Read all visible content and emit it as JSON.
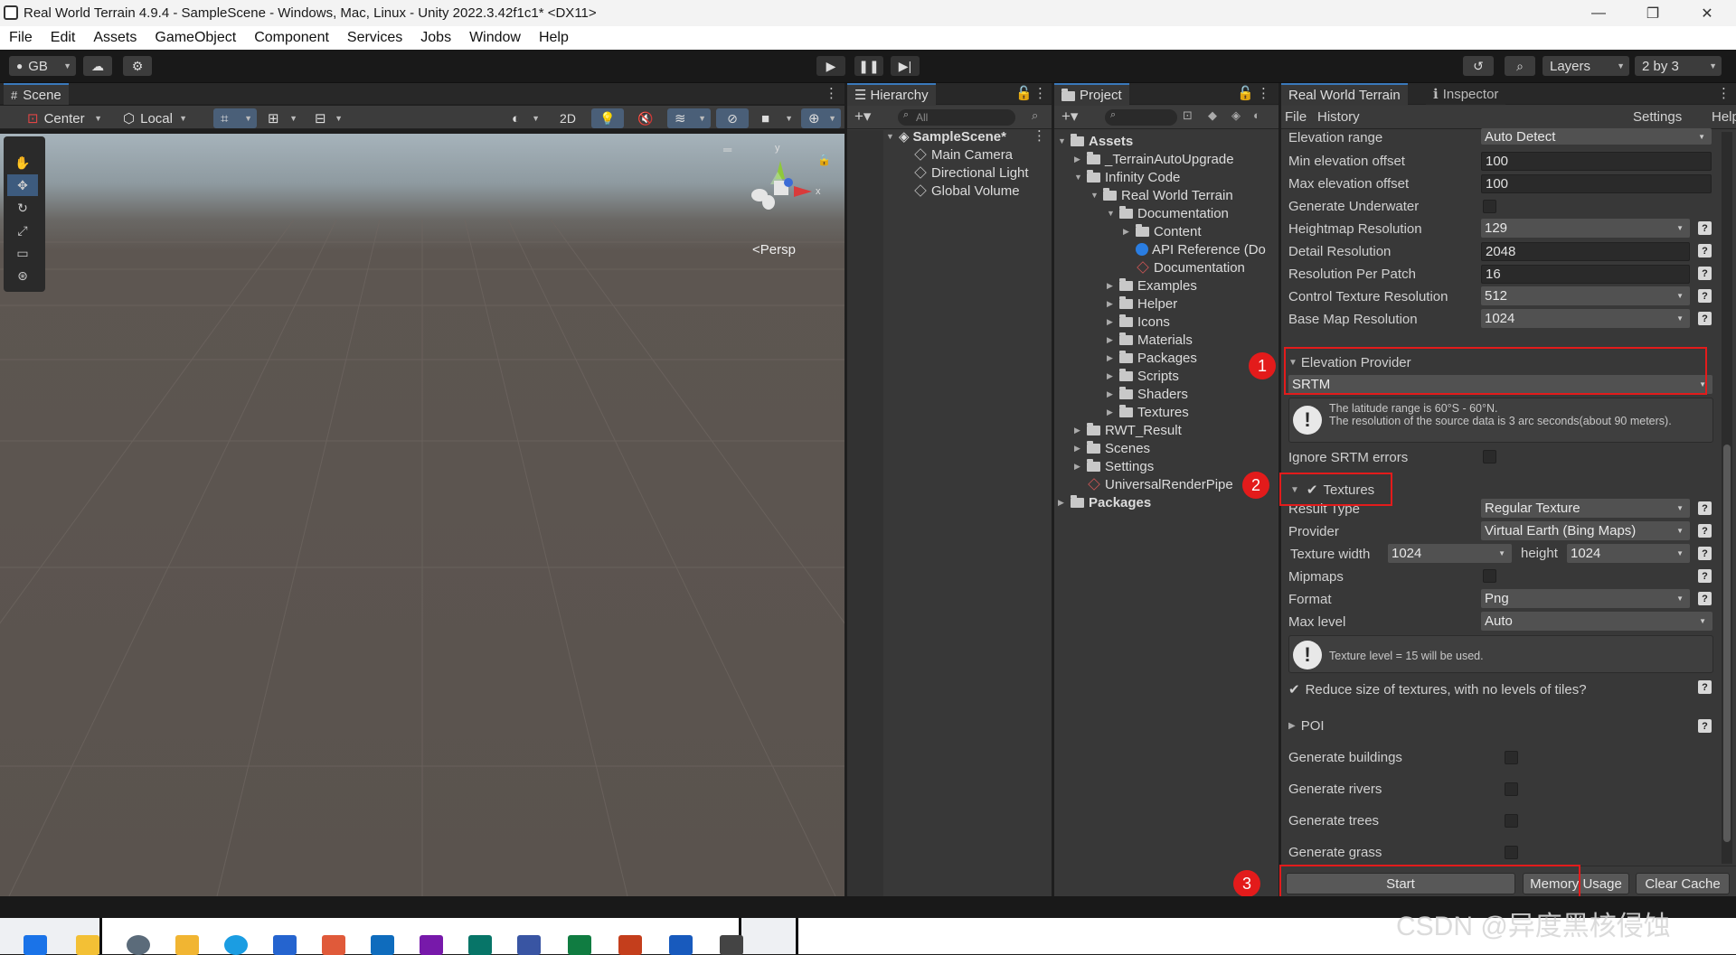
{
  "window": {
    "title": "Real World Terrain 4.9.4 - SampleScene - Windows, Mac, Linux - Unity 2022.3.42f1c1* <DX11>",
    "minimize": "—",
    "maximize": "❐",
    "close": "✕"
  },
  "menu": [
    "File",
    "Edit",
    "Assets",
    "GameObject",
    "Component",
    "Services",
    "Jobs",
    "Window",
    "Help"
  ],
  "toolbar": {
    "account": "GB",
    "layers": "Layers",
    "layout": "2 by 3"
  },
  "scene": {
    "tab": "Scene",
    "pivot": "Center",
    "space": "Local",
    "mode2d": "2D",
    "persp": "<Persp",
    "gizmo_y": "y",
    "gizmo_x": "x"
  },
  "hierarchy": {
    "tab": "Hierarchy",
    "search_placeholder": "All",
    "scene": "SampleScene*",
    "items": [
      "Main Camera",
      "Directional Light",
      "Global Volume"
    ]
  },
  "project": {
    "tab": "Project",
    "items": [
      "Assets",
      "_TerrainAutoUpgrade",
      "Infinity Code",
      "Real World Terrain",
      "Documentation",
      "Content",
      "API Reference (Do",
      "Documentation",
      "Examples",
      "Helper",
      "Icons",
      "Materials",
      "Packages",
      "Scripts",
      "Shaders",
      "Textures",
      "RWT_Result",
      "Scenes",
      "Settings",
      "UniversalRenderPipe",
      "Packages"
    ]
  },
  "rwt": {
    "tab": "Real World Terrain",
    "inspector_tab": "Inspector",
    "menu_file": "File",
    "menu_history": "History",
    "settings": "Settings",
    "help": "Help",
    "rows": [
      {
        "label": "Elevation range",
        "value": "Auto Detect"
      },
      {
        "label": "Min elevation offset",
        "value": "100"
      },
      {
        "label": "Max elevation offset",
        "value": "100"
      },
      {
        "label": "Generate Underwater",
        "value": ""
      },
      {
        "label": "Heightmap Resolution",
        "value": "129"
      },
      {
        "label": "Detail Resolution",
        "value": "2048"
      },
      {
        "label": "Resolution Per Patch",
        "value": "16"
      },
      {
        "label": "Control Texture Resolution",
        "value": "512"
      },
      {
        "label": "Base Map Resolution",
        "value": "1024"
      }
    ],
    "elevation_provider": "Elevation Provider",
    "provider_value": "SRTM",
    "srtm_info_1": "The latitude range is 60°S - 60°N.",
    "srtm_info_2": "The resolution of the source data is 3 arc seconds(about 90 meters).",
    "ignore_srtm": "Ignore SRTM errors",
    "textures": "Textures",
    "result_type": "Result Type",
    "result_type_value": "Regular Texture",
    "provider": "Provider",
    "provider_tex_value": "Virtual Earth (Bing Maps)",
    "tex_width": "Texture width",
    "tex_width_value": "1024",
    "height": "height",
    "height_value": "1024",
    "mipmaps": "Mipmaps",
    "format": "Format",
    "format_value": "Png",
    "max_level": "Max level",
    "max_level_value": "Auto",
    "tex_info": "Texture level = 15 will be used.",
    "reduce": "Reduce size of textures, with no levels of tiles?",
    "poi": "POI",
    "gen_buildings": "Generate buildings",
    "gen_rivers": "Generate rivers",
    "gen_trees": "Generate trees",
    "gen_grass": "Generate grass",
    "start": "Start",
    "memory": "Memory Usage",
    "clear_cache": "Clear Cache"
  },
  "annotations": {
    "b1": "1",
    "b2": "2",
    "b3": "3"
  },
  "watermark": "CSDN @异度黑核侵蚀"
}
